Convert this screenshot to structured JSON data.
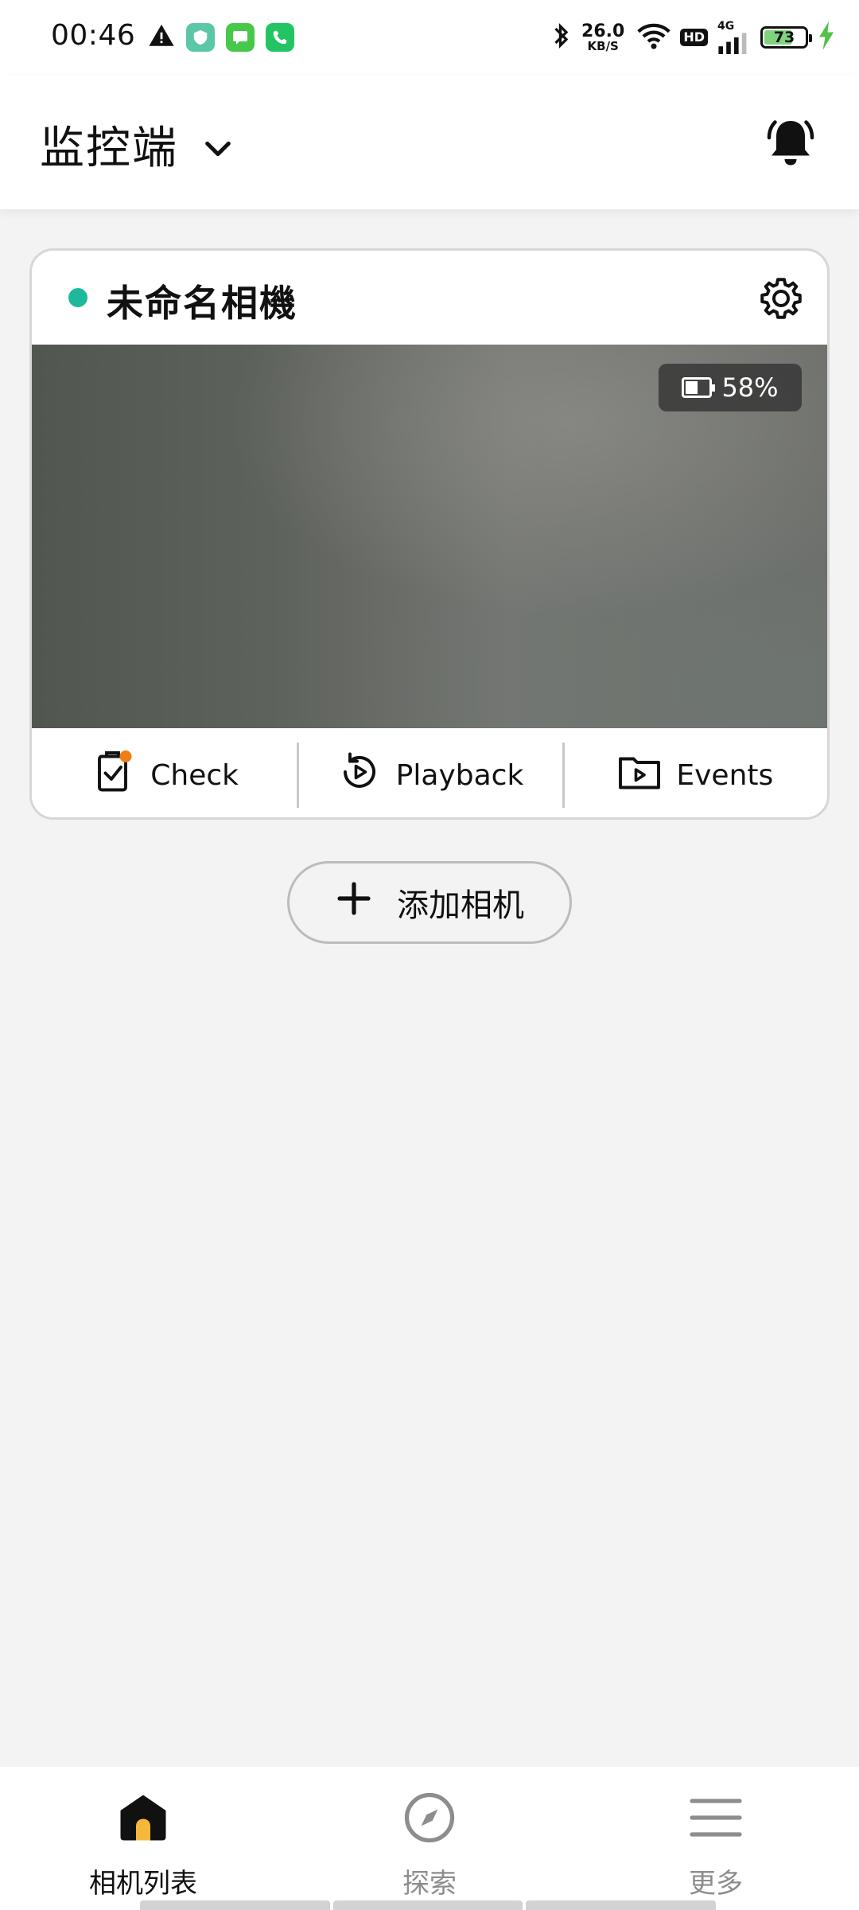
{
  "status_bar": {
    "time": "00:46",
    "net_speed": "26.0",
    "net_unit": "KB/S",
    "hd": "HD",
    "network": "4G",
    "battery_level": "73",
    "icons": [
      "warning-icon",
      "app-icon-green",
      "chat-icon",
      "phone-icon",
      "bluetooth-icon",
      "wifi-icon",
      "signal-icon",
      "charging-icon"
    ],
    "battery_fill": 0.73,
    "battery_color": "#7fd37e",
    "charging_color": "#52c24a"
  },
  "header": {
    "title": "监控端",
    "icons": [
      "chevron-down-icon",
      "bell-icon"
    ]
  },
  "camera_card": {
    "name": "未命名相機",
    "status_color": "#1db99a",
    "battery_percent": "58%",
    "battery_fill": 0.58,
    "actions": [
      {
        "label": "Check",
        "icon": "check-clipboard-icon",
        "badge_color": "#f07d15"
      },
      {
        "label": "Playback",
        "icon": "playback-icon"
      },
      {
        "label": "Events",
        "icon": "events-folder-icon"
      }
    ]
  },
  "add_camera": {
    "label": "添加相机"
  },
  "bottom_nav": {
    "items": [
      {
        "label": "相机列表",
        "icon": "home-icon",
        "active": true,
        "accent": "#f6b83c"
      },
      {
        "label": "探索",
        "icon": "compass-icon",
        "active": false
      },
      {
        "label": "更多",
        "icon": "menu-icon",
        "active": false
      }
    ]
  }
}
